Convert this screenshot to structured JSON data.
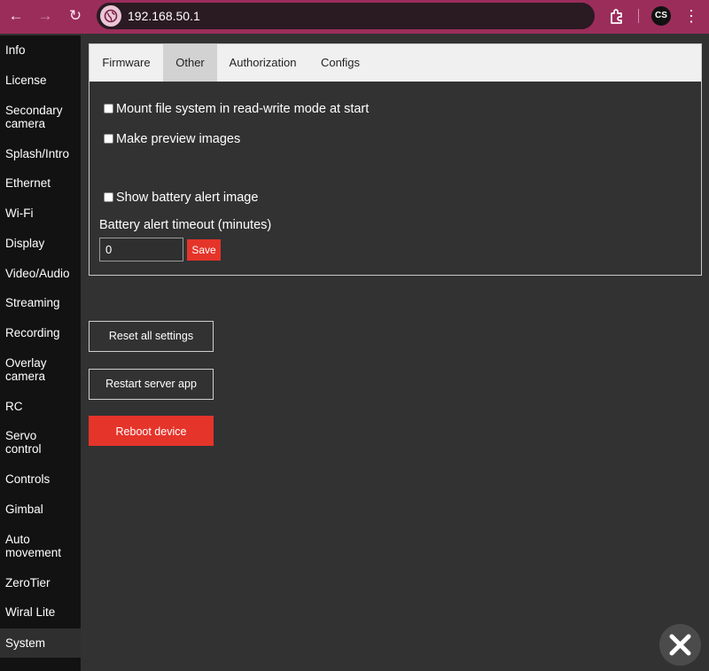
{
  "browser": {
    "url": "192.168.50.1",
    "back_icon": "←",
    "forward_icon": "→",
    "reload_icon": "↻",
    "menu_icon": "⋮",
    "profile_initials": "CS"
  },
  "sidebar": {
    "items": [
      {
        "label": "Info"
      },
      {
        "label": "License"
      },
      {
        "label": "Secondary camera"
      },
      {
        "label": "Splash/Intro"
      },
      {
        "label": "Ethernet"
      },
      {
        "label": "Wi-Fi"
      },
      {
        "label": "Display"
      },
      {
        "label": "Video/Audio"
      },
      {
        "label": "Streaming"
      },
      {
        "label": "Recording"
      },
      {
        "label": "Overlay camera"
      },
      {
        "label": "RC"
      },
      {
        "label": "Servo control"
      },
      {
        "label": "Controls"
      },
      {
        "label": "Gimbal"
      },
      {
        "label": "Auto movement"
      },
      {
        "label": "ZeroTier"
      },
      {
        "label": "Wiral Lite"
      },
      {
        "label": "System"
      }
    ],
    "active": "System"
  },
  "tabs": [
    {
      "label": "Firmware"
    },
    {
      "label": "Other"
    },
    {
      "label": "Authorization"
    },
    {
      "label": "Configs"
    }
  ],
  "active_tab": "Other",
  "options": {
    "mount_rw": {
      "label": "Mount file system in read-write mode at start",
      "checked": false
    },
    "preview_images": {
      "label": "Make preview images",
      "checked": false
    },
    "battery_alert_image": {
      "label": "Show battery alert image",
      "checked": false
    }
  },
  "battery_timeout": {
    "label": "Battery alert timeout (minutes)",
    "value": "0",
    "save_label": "Save"
  },
  "actions": {
    "reset_label": "Reset all settings",
    "restart_label": "Restart server app",
    "reboot_label": "Reboot device"
  },
  "colors": {
    "browser_bar": "#9b2d5b",
    "accent_red": "#e5342a",
    "background": "#323232",
    "sidebar": "#121212"
  }
}
